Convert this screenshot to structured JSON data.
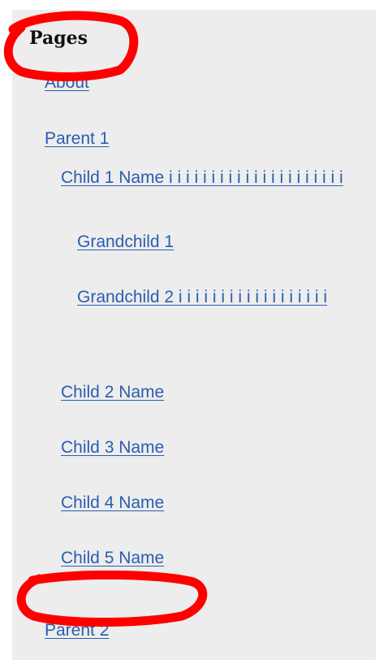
{
  "sidebar": {
    "heading": "Pages",
    "items": [
      {
        "label": "About"
      },
      {
        "label": "Parent 1"
      },
      {
        "label": "Child 1 Name i i i i i i i i i i i i i i i i i i i i i"
      },
      {
        "label": "Grandchild 1"
      },
      {
        "label": "Grandchild 2 i i i i i i i i i i i i i i i i i i"
      },
      {
        "label": "Child 2 Name"
      },
      {
        "label": "Child 3 Name"
      },
      {
        "label": "Child 4 Name"
      },
      {
        "label": "Child 5 Name"
      },
      {
        "label": "Parent 2"
      }
    ]
  },
  "colors": {
    "panel_bg": "#ededed",
    "link": "#2a5db0",
    "annotation": "#ff0000"
  }
}
